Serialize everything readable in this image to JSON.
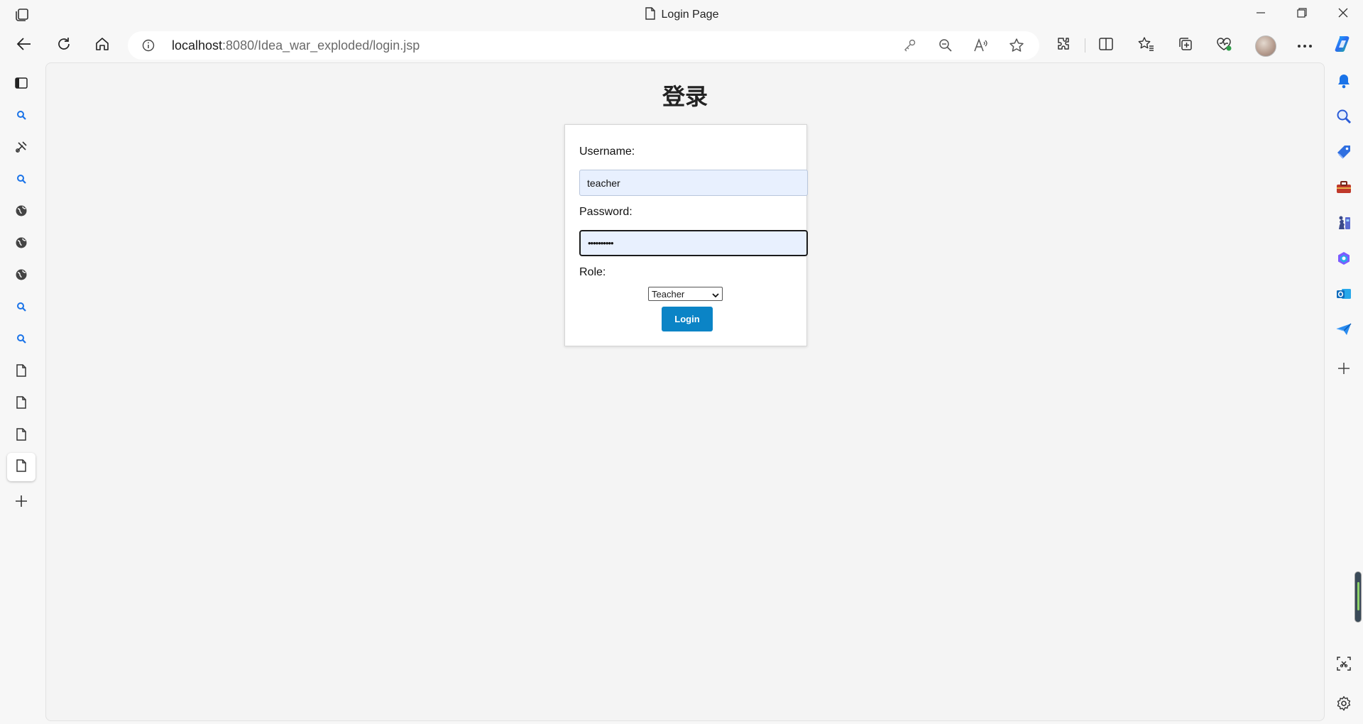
{
  "window": {
    "title": "Login Page",
    "icons": [
      "tabs-icon",
      "document-icon",
      "minimize-icon",
      "restore-icon",
      "close-icon"
    ]
  },
  "navbar": {
    "url_host": "localhost",
    "url_rest": ":8080/Idea_war_exploded/login.jsp",
    "icons": [
      "back-icon",
      "refresh-icon",
      "home-icon",
      "info-icon",
      "key-icon",
      "zoom-out-icon",
      "read-aloud-icon",
      "favorite-star-icon",
      "extensions-icon",
      "split-screen-icon",
      "favorites-icon",
      "collections-icon",
      "browser-essentials-icon",
      "profile-avatar",
      "more-icon",
      "copilot-icon"
    ]
  },
  "left_sidebar": {
    "tabs": [
      "tab-actions-icon",
      "search-icon",
      "sword-icon",
      "search-icon",
      "globe-icon",
      "globe-icon",
      "globe-icon",
      "search-icon",
      "search-icon",
      "page-icon",
      "page-icon",
      "page-icon",
      "page-icon",
      "new-tab-icon"
    ],
    "active_index": 12
  },
  "right_sidebar": {
    "icons": [
      "bell-icon",
      "search-icon",
      "shopping-tag-icon",
      "toolbox-icon",
      "games-icon",
      "microsoft-365-icon",
      "outlook-icon",
      "send-icon",
      "add-icon",
      "screenshot-icon",
      "settings-icon"
    ],
    "colors": {
      "blue": "#1a73e8",
      "red": "#c0392b",
      "outlook": "#0f6cbd"
    }
  },
  "page": {
    "heading": "登录",
    "username_label": "Username:",
    "username_value": "teacher",
    "password_label": "Password:",
    "password_value": "••••••••••",
    "role_label": "Role:",
    "role_selected": "Teacher",
    "login_button": "Login",
    "accent_color": "#0b84c6",
    "autofill_color": "#e8f0fe"
  }
}
